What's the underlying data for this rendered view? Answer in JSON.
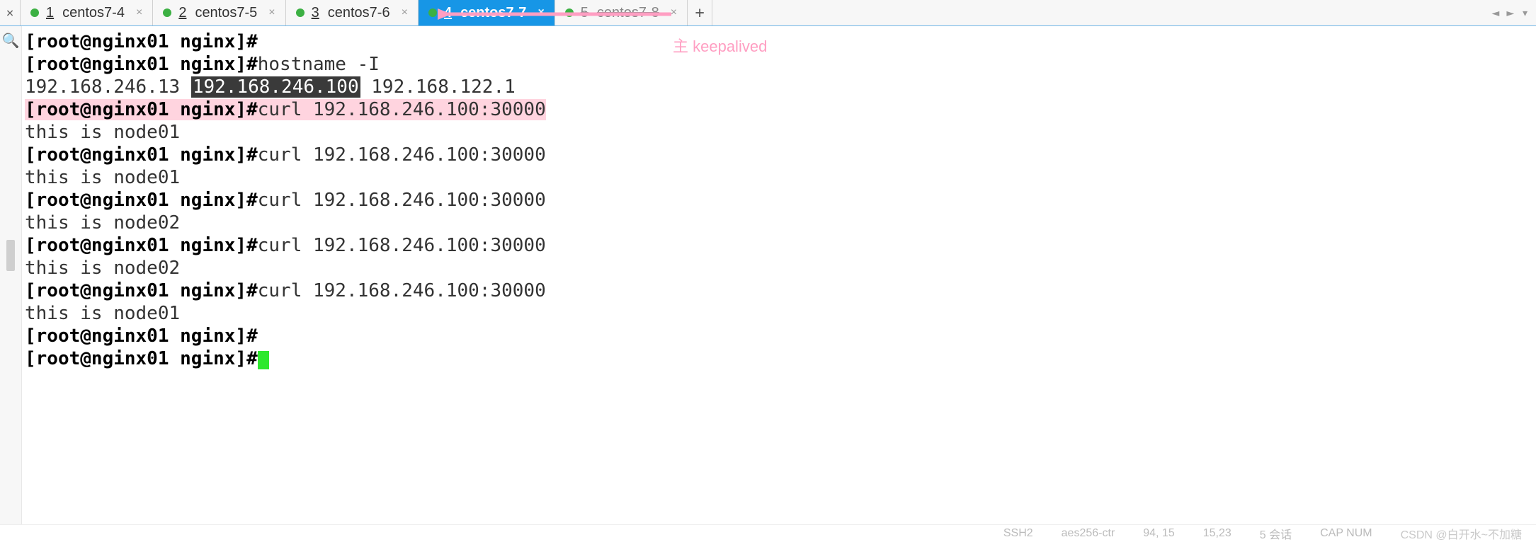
{
  "tabs": [
    {
      "num": "1",
      "label": "centos7-4",
      "active": false,
      "struck": false
    },
    {
      "num": "2",
      "label": "centos7-5",
      "active": false,
      "struck": false
    },
    {
      "num": "3",
      "label": "centos7-6",
      "active": false,
      "struck": false
    },
    {
      "num": "4",
      "label": "centos7-7",
      "active": true,
      "struck": false
    },
    {
      "num": "5",
      "label": "centos7-8",
      "active": false,
      "struck": true
    }
  ],
  "new_tab_label": "+",
  "annotation": "主  keepalived",
  "prompt": "[root@nginx01 nginx]#",
  "lines": {
    "l1_cmd": "hostname -I",
    "l2_ip1": "192.168.246.13 ",
    "l2_ip_hl": "192.168.246.100",
    "l2_ip3": " 192.168.122.1",
    "curl_cmd": "curl 192.168.246.100:30000",
    "resp_node01": "this is node01",
    "resp_node02": "this is node02"
  },
  "status": {
    "proto": "SSH2",
    "enc": "aes256-ctr",
    "size": "94, 15",
    "pos": "15,23",
    "sess": "5 会话",
    "caps": "CAP  NUM"
  },
  "watermark": "CSDN @白开水~不加糖"
}
